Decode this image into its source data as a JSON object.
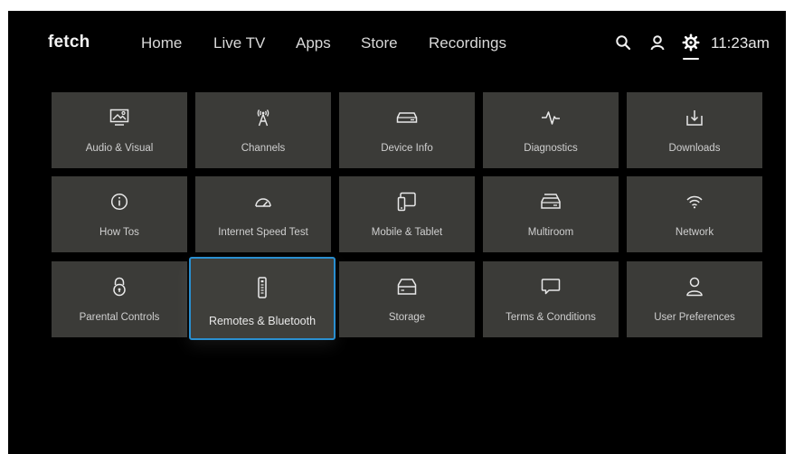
{
  "app": {
    "logo": "fetch",
    "clock": "11:23am"
  },
  "nav": {
    "items": [
      {
        "label": "Home"
      },
      {
        "label": "Live TV"
      },
      {
        "label": "Apps"
      },
      {
        "label": "Store"
      },
      {
        "label": "Recordings"
      }
    ]
  },
  "toolbar": {
    "search_icon": "search-icon",
    "profile_icon": "user-icon",
    "settings_icon": "gear-icon",
    "settings_selected": true
  },
  "settings": {
    "focused_tile": "Remotes & Bluetooth",
    "accent_color": "#2a8fd0",
    "tiles": [
      {
        "label": "Audio & Visual",
        "icon": "picture-icon"
      },
      {
        "label": "Channels",
        "icon": "antenna-icon"
      },
      {
        "label": "Device Info",
        "icon": "set-top-box-icon"
      },
      {
        "label": "Diagnostics",
        "icon": "pulse-icon"
      },
      {
        "label": "Downloads",
        "icon": "download-icon"
      },
      {
        "label": "How Tos",
        "icon": "info-icon"
      },
      {
        "label": "Internet Speed Test",
        "icon": "speedometer-icon"
      },
      {
        "label": "Mobile & Tablet",
        "icon": "mobile-tablet-icon"
      },
      {
        "label": "Multiroom",
        "icon": "multiroom-icon"
      },
      {
        "label": "Network",
        "icon": "wifi-icon"
      },
      {
        "label": "Parental Controls",
        "icon": "lock-icon"
      },
      {
        "label": "Remotes & Bluetooth",
        "icon": "remote-icon"
      },
      {
        "label": "Storage",
        "icon": "storage-icon"
      },
      {
        "label": "Terms & Conditions",
        "icon": "message-icon"
      },
      {
        "label": "User Preferences",
        "icon": "user-icon"
      }
    ]
  }
}
